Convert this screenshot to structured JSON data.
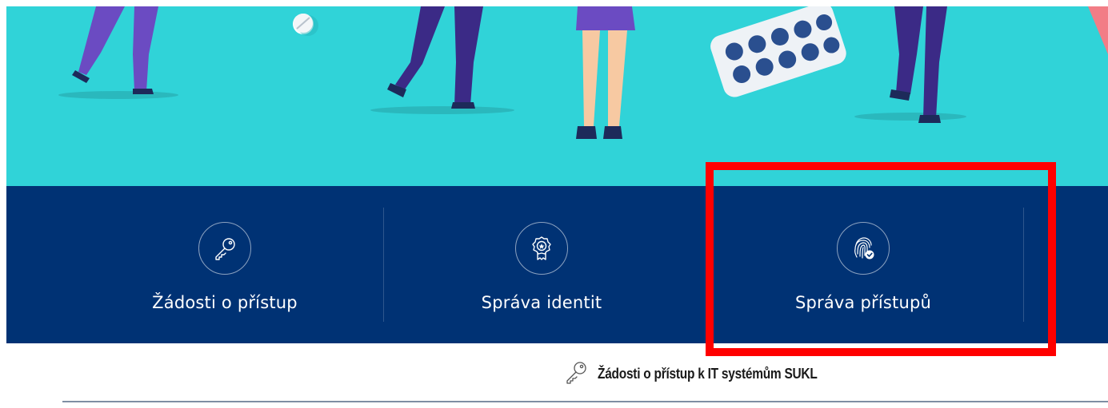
{
  "colors": {
    "hero_background": "#30d3d8",
    "nav_background": "#003274",
    "highlight": "#ff0000",
    "text_light": "#ffffff",
    "text_dark": "#1a1a1a"
  },
  "hero": {
    "illustration": "people-walking-with-pills-illustration"
  },
  "nav": {
    "items": [
      {
        "label": "Žádosti o přístup",
        "icon": "key-icon"
      },
      {
        "label": "Správa identit",
        "icon": "badge-icon"
      },
      {
        "label": "Správa přístupů",
        "icon": "fingerprint-icon"
      }
    ]
  },
  "section": {
    "title": "Žádosti o přístup k IT systémům SUKL",
    "icon": "key-icon"
  }
}
